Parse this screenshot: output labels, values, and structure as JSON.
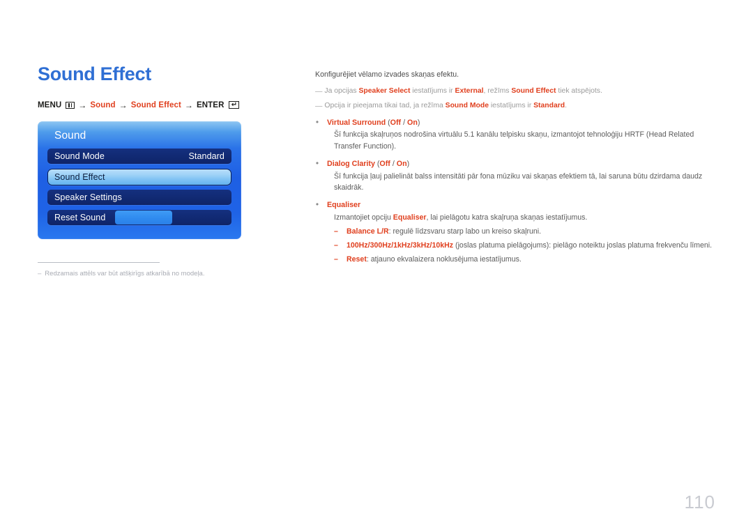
{
  "page": {
    "title": "Sound Effect",
    "number": "110",
    "title_color": "#2f6fd4",
    "accent_color": "#e0401f"
  },
  "menu_path": {
    "menu_label": "MENU",
    "menu_icon": "menu-bars-icon",
    "arrow": "→",
    "step1": "Sound",
    "step2": "Sound Effect",
    "enter_label": "ENTER",
    "enter_icon": "enter-return-icon",
    "enter_glyph": "↵"
  },
  "osd": {
    "title": "Sound",
    "rows": [
      {
        "label": "Sound Mode",
        "value": "Standard",
        "selected": false,
        "has_bar": false
      },
      {
        "label": "Sound Effect",
        "value": "",
        "selected": true,
        "has_bar": false
      },
      {
        "label": "Speaker Settings",
        "value": "",
        "selected": false,
        "has_bar": false
      },
      {
        "label": "Reset Sound",
        "value": "",
        "selected": false,
        "has_bar": true
      }
    ]
  },
  "footnote": {
    "dash": "–",
    "text": "Redzamais attēls var būt atšķirīgs atkarībā no modeļa."
  },
  "content": {
    "intro": "Konfigurējiet vēlamo izvades skaņas efektu.",
    "notes": [
      {
        "dash": "—",
        "p1": "Ja opcijas ",
        "b1": "Speaker Select",
        "p2": " iestatījums ir ",
        "b2": "External",
        "p3": ", režīms ",
        "b3": "Sound Effect",
        "p4": " tiek atspējots."
      },
      {
        "dash": "—",
        "p1": "Opcija ir pieejama tikai tad, ja režīma ",
        "b1": "Sound Mode",
        "p2": " iestatījums ir ",
        "b2": "Standard",
        "p3": ".",
        "b3": "",
        "p4": ""
      }
    ],
    "bullets": [
      {
        "dot": "•",
        "name": "Virtual Surround",
        "options_open": " (",
        "option_a": "Off",
        "options_sep": " / ",
        "option_b": "On",
        "options_close": ")",
        "body": "Šī funkcija skaļruņos nodrošina virtuālu 5.1 kanālu telpisku skaņu, izmantojot tehnoloģiju HRTF (Head Related Transfer Function)."
      },
      {
        "dot": "•",
        "name": "Dialog Clarity",
        "options_open": " (",
        "option_a": "Off",
        "options_sep": " / ",
        "option_b": "On",
        "options_close": ")",
        "body": "Šī funkcija ļauj palielināt balss intensitāti pār fona mūziku vai skaņas efektiem tā, lai saruna būtu dzirdama daudz skaidrāk."
      }
    ],
    "equaliser": {
      "dot": "•",
      "name": "Equaliser",
      "body_p1": "Izmantojiet opciju ",
      "body_b1": "Equaliser",
      "body_p2": ", lai pielāgotu katra skaļruņa skaņas iestatījumus.",
      "subitems": [
        {
          "dash": "–",
          "term": "Balance L/R",
          "desc": ": regulē līdzsvaru starp labo un kreiso skaļruni."
        },
        {
          "dash": "–",
          "term": "100Hz/300Hz/1kHz/3kHz/10kHz",
          "desc": " (joslas platuma pielāgojums): pielāgo noteiktu joslas platuma frekvenču līmeni."
        },
        {
          "dash": "–",
          "term": "Reset",
          "desc": ": atjauno ekvalaizera noklusējuma iestatījumus."
        }
      ]
    }
  }
}
